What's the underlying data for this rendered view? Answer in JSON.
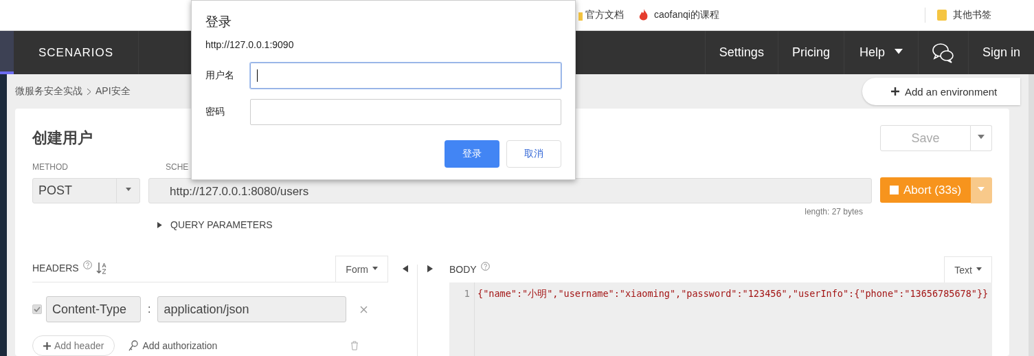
{
  "bookmarks": [
    {
      "label": "官方文档",
      "kind": "doc"
    },
    {
      "label": "caofanqi的课程",
      "kind": "flame"
    }
  ],
  "other_bookmarks": "其他书签",
  "navbar": {
    "brand": "SCENARIOS",
    "items": [
      {
        "label": "Settings",
        "kind": "link"
      },
      {
        "label": "Pricing",
        "kind": "link"
      },
      {
        "label": "Help",
        "kind": "dropdown"
      },
      {
        "kind": "chat"
      },
      {
        "label": "Sign in",
        "kind": "link"
      }
    ]
  },
  "breadcrumb": [
    "微服务安全实战",
    "API安全"
  ],
  "add_environment": "Add an environment",
  "request": {
    "title": "创建用户",
    "save": "Save",
    "method_label": "METHOD",
    "method": "POST",
    "scheme_label": "SCHE",
    "url": "http://127.0.0.1:8080/users",
    "abort": "Abort (33s)",
    "length": "length: 27 bytes",
    "query_parameters": "QUERY PARAMETERS",
    "query_expanded": false
  },
  "headers": {
    "title": "HEADERS",
    "mode": "Form",
    "rows": [
      {
        "name": "Content-Type",
        "separator": ":",
        "value": "application/json",
        "checked": true
      }
    ],
    "add_header": "Add header",
    "add_authorization": "Add authorization"
  },
  "body": {
    "title": "BODY",
    "mode": "Text",
    "lines": [
      {
        "number": "1",
        "code": "{\"name\":\"小明\",\"username\":\"xiaoming\",\"password\":\"123456\",\"userInfo\":{\"phone\":\"13656785678\"}}"
      }
    ]
  },
  "dialog": {
    "title": "登录",
    "origin": "http://127.0.0.1:9090",
    "fields": [
      {
        "label": "用户名",
        "focused": true
      },
      {
        "label": "密码",
        "focused": false
      }
    ],
    "buttons": [
      {
        "label": "登录",
        "kind": "primary"
      },
      {
        "label": "取消",
        "kind": "secondary"
      }
    ]
  }
}
